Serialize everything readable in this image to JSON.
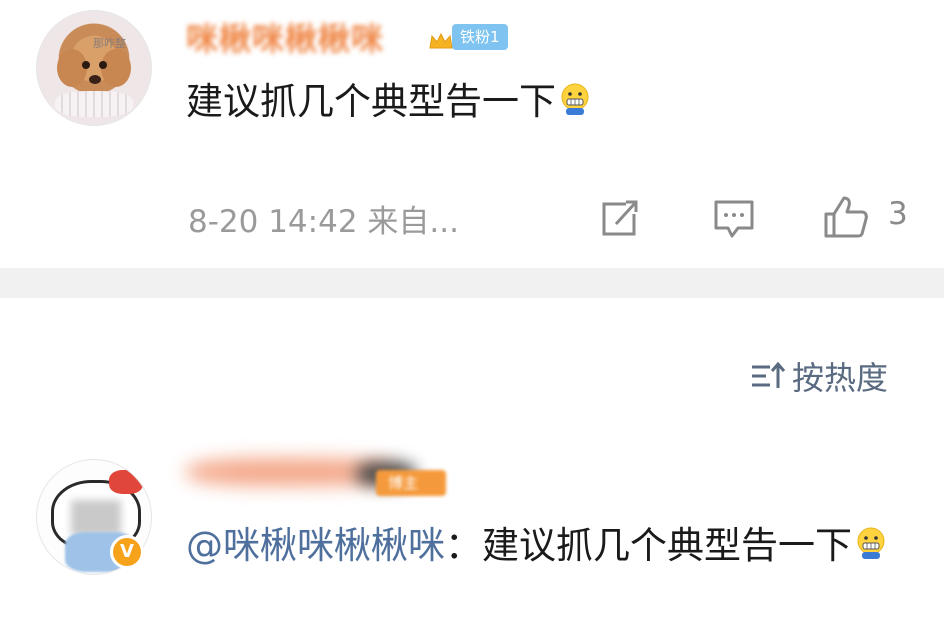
{
  "comment": {
    "author_name": "咪楸咪楸楸咪",
    "fan_badge": "铁粉1",
    "avatar_tag": "那咋整",
    "text": "建议抓几个典型告一下",
    "emoji_icon": "grimace-emoji-icon",
    "meta": "8-20 14:42 来自...",
    "like_count": "3"
  },
  "sort": {
    "label": "按热度",
    "icon": "sort-icon"
  },
  "reply": {
    "fan_badge": "博主",
    "verified_badge": "V",
    "mention": "@咪楸咪楸楸咪",
    "separator": "：",
    "text": "建议抓几个典型告一下"
  },
  "colors": {
    "mention_blue": "#4f6f9d",
    "name_orange": "#f08a4b",
    "fan_badge_blue": "#7fc4f0",
    "meta_gray": "#9a9a9a",
    "verified_orange": "#f7a21b"
  }
}
